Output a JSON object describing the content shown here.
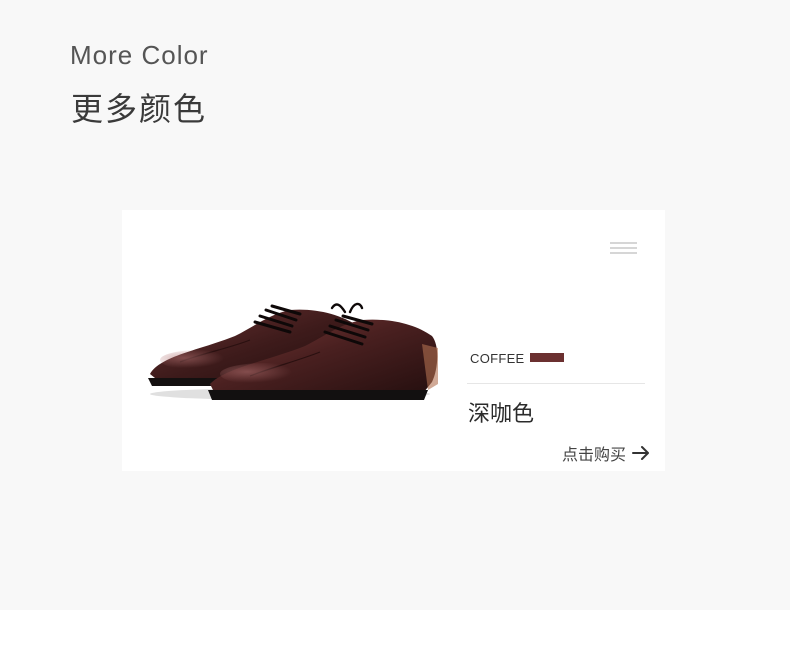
{
  "section": {
    "title_en": "More Color",
    "title_cn": "更多颜色"
  },
  "product_card": {
    "image_icon": "dress-shoes-image",
    "menu_icon": "menu-lines-icon",
    "color_code": "COFFEE",
    "swatch_color": "#6b3030",
    "color_name": "深咖色",
    "buy_label": "点击购买",
    "buy_icon": "arrow-right-icon"
  },
  "colors": {
    "page_background": "#f8f8f8",
    "card_background": "#ffffff",
    "heading_text": "#555555",
    "shoe_leather": "#3c1c1c"
  }
}
